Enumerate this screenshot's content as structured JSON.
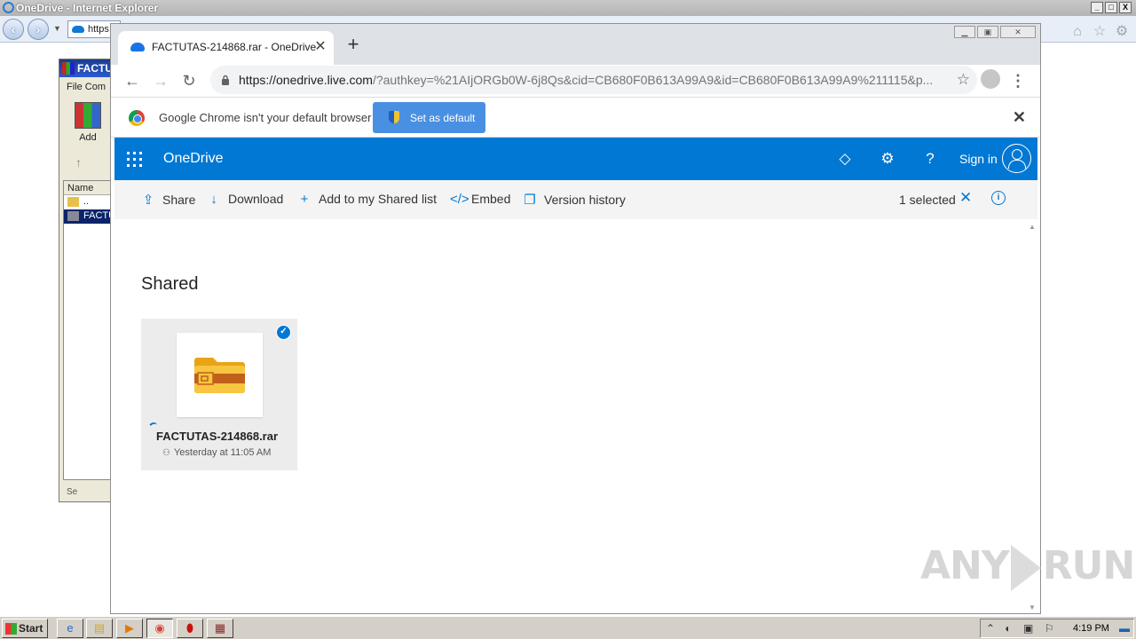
{
  "ie": {
    "title": "OneDrive - Internet Explorer",
    "address": "https",
    "min": "_",
    "max": "□",
    "close": "X"
  },
  "winrar": {
    "title": "FACTU",
    "menu": "File  Com",
    "add_label": "Add",
    "col_name": "Name",
    "rows": [
      {
        "label": ".."
      },
      {
        "label": "FACTU"
      }
    ],
    "status": "Se"
  },
  "chrome": {
    "tab_title": "FACTUTAS-214868.rar - OneDrive",
    "tab_close": "✕",
    "new_tab": "+",
    "url_host": "https://onedrive.live.com",
    "url_rest": "/?authkey=%21AIjORGb0W-6j8Qs&cid=CB680F0B613A99A9&id=CB680F0B613A99A9%211115&p...",
    "infobar_message": "Google Chrome isn't your default browser",
    "set_default": "Set as default",
    "infobar_close": "✕"
  },
  "onedrive": {
    "brand": "OneDrive",
    "sign_in": "Sign in",
    "commands": {
      "share": "Share",
      "download": "Download",
      "add_shared": "Add to my Shared list",
      "embed": "Embed",
      "version_history": "Version history"
    },
    "selected": "1 selected",
    "heading": "Shared",
    "file": {
      "name": "FACTUTAS-214868.rar",
      "modified": "Yesterday at 11:05 AM",
      "selected": true
    },
    "colors": {
      "header": "#0078d4",
      "accent": "#0078d4",
      "folder": "#f8c540"
    }
  },
  "watermark": {
    "left": "ANY",
    "right": "RUN"
  },
  "taskbar": {
    "start": "Start",
    "clock": "4:19 PM"
  }
}
